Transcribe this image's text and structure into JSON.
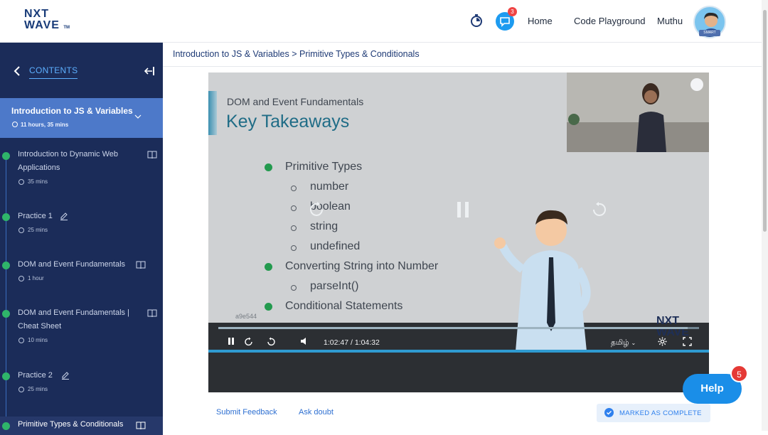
{
  "header": {
    "logo_line1": "NXT",
    "logo_line2": "WAVE",
    "logo_tm": "TM",
    "chat_badge": "3",
    "nav_home": "Home",
    "nav_playground": "Code Playground",
    "user_name": "Muthu",
    "avatar_tag": "SMART"
  },
  "sidebar": {
    "contents_label": "CONTENTS",
    "module_title": "Introduction to JS & Variables",
    "module_time": "11 hours, 35 mins",
    "items": [
      {
        "title": "Introduction to Dynamic Web Applications",
        "time": "35 mins",
        "icon": "book-icon"
      },
      {
        "title": "Practice 1",
        "time": "25 mins",
        "icon": "pen-icon"
      },
      {
        "title": "DOM and Event Fundamentals",
        "time": "1 hour",
        "icon": "book-icon"
      },
      {
        "title": "DOM and Event Fundamentals | Cheat Sheet",
        "time": "10 mins",
        "icon": "book-icon"
      },
      {
        "title": "Practice 2",
        "time": "25 mins",
        "icon": "pen-icon"
      },
      {
        "title": "Primitive Types & Conditionals",
        "time": "",
        "icon": "book-icon"
      }
    ]
  },
  "content": {
    "breadcrumb": "Introduction to JS & Variables > Primitive Types & Conditionals",
    "slide": {
      "subtitle": "DOM and Event Fundamentals",
      "title": "Key Takeaways",
      "bullets": [
        {
          "text": "Primitive Types",
          "level": 1
        },
        {
          "text": "number",
          "level": 2
        },
        {
          "text": "boolean",
          "level": 2
        },
        {
          "text": "string",
          "level": 2
        },
        {
          "text": "undefined",
          "level": 2
        },
        {
          "text": "Converting String into Number",
          "level": 1
        },
        {
          "text": "parseInt()",
          "level": 2
        },
        {
          "text": "Conditional Statements",
          "level": 1
        }
      ],
      "watermark_line1": "NXT",
      "watermark_line2": "WAVE",
      "video_id": "a9e544"
    },
    "player": {
      "current_time": "1:02:47",
      "separator": "/",
      "duration": "1:04:32",
      "language": "தமிழ்",
      "progress": 0.976
    },
    "actions": {
      "feedback": "Submit Feedback",
      "ask_doubt": "Ask doubt",
      "complete": "MARKED AS COMPLETE"
    }
  },
  "help": {
    "label": "Help",
    "badge": "5"
  },
  "colors": {
    "sidebar_bg": "#1b2c59",
    "module_bg": "#4d79c9",
    "accent_blue": "#2f80ed",
    "help_blue": "#1a8ee8",
    "check_green": "#2fb56a"
  }
}
